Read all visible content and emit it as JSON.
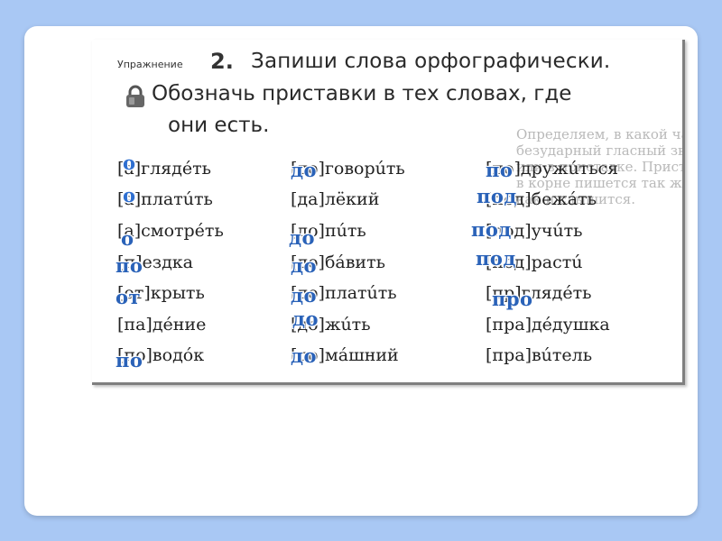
{
  "exercise": {
    "label": "Упражнение",
    "number": "2.",
    "line1": "Запиши слова орфографически.",
    "line2": "Обозначь приставки в тех словах, где",
    "line3": "они есть."
  },
  "background_text": [
    "Определяем, в какой части слова",
    "безударный гласный звук — в корне",
    "или в приставке. Приставка",
    "в корне пишется так же,",
    "как и слышится."
  ],
  "col1": [
    "[а]глядéть",
    "[а]платúть",
    "[а]смотрéть",
    "[п]ездка",
    "[от]крыть",
    "[па]дéние",
    "[по]водóк"
  ],
  "col2": [
    "[до]говорúть",
    "[да]лёкий",
    "[до]пúть",
    "[до]бáвить",
    "[до]платúть",
    "[до]жúть",
    "[до]мáшний"
  ],
  "col3": [
    "[по]дружúться",
    "[под]бежáть",
    "[под]учúть",
    "[под]растú",
    "[пр]глядéть",
    "[пра]дéдушка",
    "[пра]вúтель"
  ],
  "answers": {
    "col1": [
      "о",
      "о",
      "о",
      "по",
      "от",
      "",
      "по"
    ],
    "col2": [
      "до",
      "",
      "до",
      "до",
      "до",
      "до",
      "до"
    ],
    "col3": [
      "по",
      "под",
      "под",
      "под",
      "про",
      "",
      ""
    ]
  }
}
